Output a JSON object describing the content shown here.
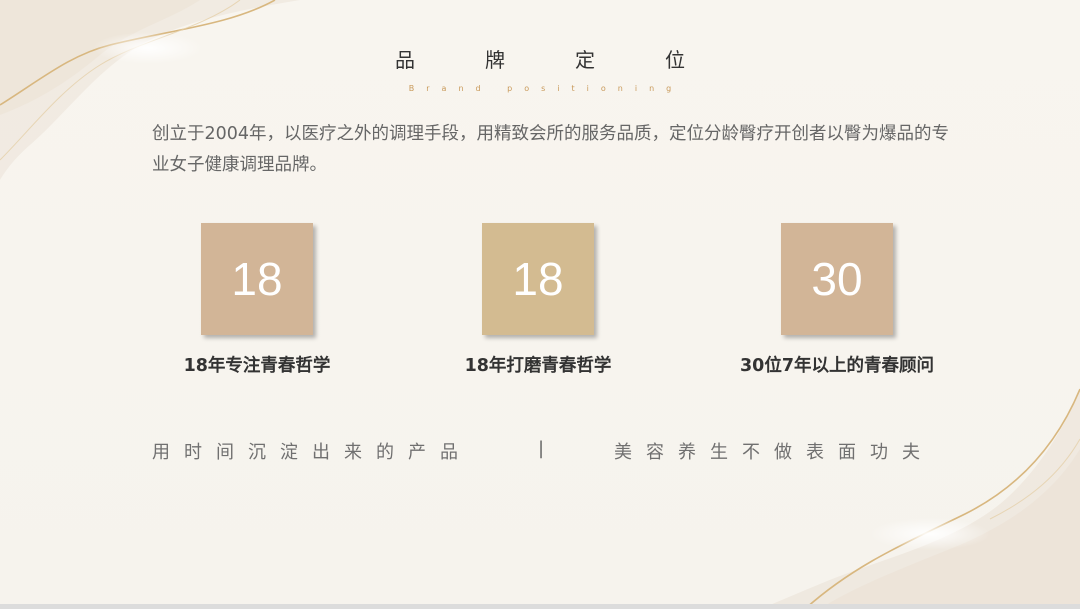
{
  "header": {
    "title": "品牌定位",
    "subtitle": "Brand positioning"
  },
  "intro": {
    "text": "创立于2004年，以医疗之外的调理手段，用精致会所的服务品质，定位分龄臀疗开创者以臀为爆品的专业女子健康调理品牌。"
  },
  "stats": [
    {
      "value": "18",
      "label": "18年专注青春哲学",
      "color": "#d2b597"
    },
    {
      "value": "18",
      "label": "18年打磨青春哲学",
      "color": "#d3bb91"
    },
    {
      "value": "30",
      "label": "30位7年以上的青春顾问",
      "color": "#d2b597"
    }
  ],
  "tagline": {
    "left": "用时间沉淀出来的产品",
    "separator": "|",
    "right": "美容养生不做表面功夫"
  },
  "colors": {
    "background": "#f7f4ee",
    "accent_gold": "#c99a5b",
    "title_text": "#333333",
    "body_text": "#666666"
  }
}
